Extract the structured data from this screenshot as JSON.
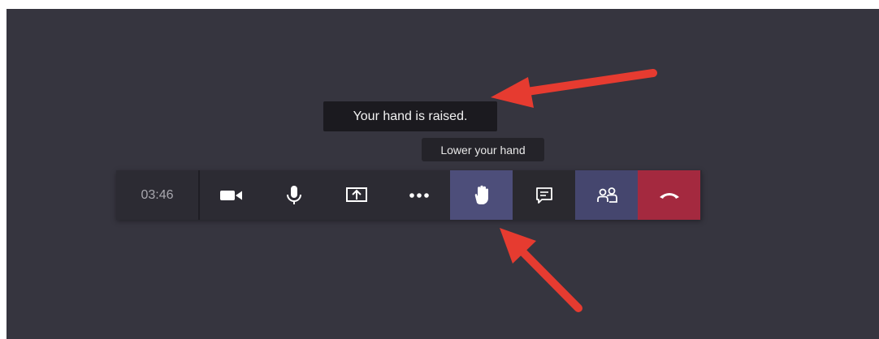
{
  "notification": {
    "text": "Your hand is raised."
  },
  "tooltip": {
    "text": "Lower your hand"
  },
  "call_bar": {
    "timer": "03:46",
    "buttons": [
      {
        "name": "camera",
        "icon": "video-camera-icon"
      },
      {
        "name": "microphone",
        "icon": "microphone-icon"
      },
      {
        "name": "share",
        "icon": "share-screen-icon"
      },
      {
        "name": "more",
        "icon": "more-options-icon"
      },
      {
        "name": "raise-hand",
        "icon": "hand-icon",
        "active": true
      },
      {
        "name": "chat",
        "icon": "chat-icon"
      },
      {
        "name": "participants",
        "icon": "people-icon"
      },
      {
        "name": "leave",
        "icon": "hang-up-icon"
      }
    ]
  },
  "colors": {
    "stage_bg": "#36353f",
    "bar_bg": "#2c2b33",
    "active_bg": "#4d4e7a",
    "people_bg": "#45466e",
    "leave_bg": "#a4293f",
    "annotation_arrow": "#e63b30"
  }
}
